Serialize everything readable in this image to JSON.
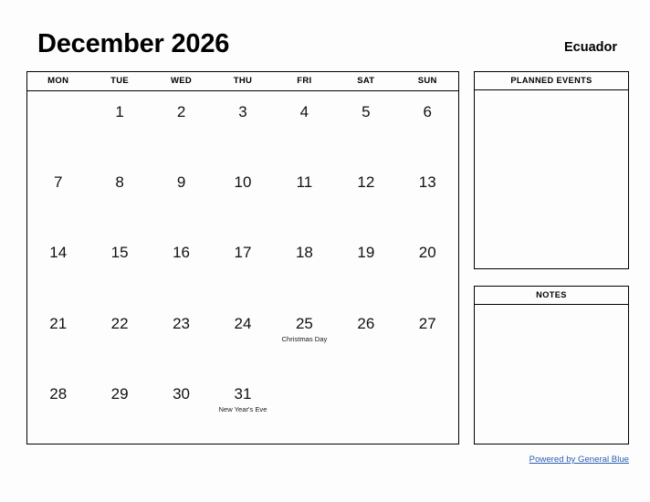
{
  "header": {
    "month_title": "December 2026",
    "country": "Ecuador"
  },
  "calendar": {
    "weekdays": [
      "MON",
      "TUE",
      "WED",
      "THU",
      "FRI",
      "SAT",
      "SUN"
    ],
    "weeks": [
      [
        {
          "day": "",
          "event": ""
        },
        {
          "day": "1",
          "event": ""
        },
        {
          "day": "2",
          "event": ""
        },
        {
          "day": "3",
          "event": ""
        },
        {
          "day": "4",
          "event": ""
        },
        {
          "day": "5",
          "event": ""
        },
        {
          "day": "6",
          "event": ""
        }
      ],
      [
        {
          "day": "7",
          "event": ""
        },
        {
          "day": "8",
          "event": ""
        },
        {
          "day": "9",
          "event": ""
        },
        {
          "day": "10",
          "event": ""
        },
        {
          "day": "11",
          "event": ""
        },
        {
          "day": "12",
          "event": ""
        },
        {
          "day": "13",
          "event": ""
        }
      ],
      [
        {
          "day": "14",
          "event": ""
        },
        {
          "day": "15",
          "event": ""
        },
        {
          "day": "16",
          "event": ""
        },
        {
          "day": "17",
          "event": ""
        },
        {
          "day": "18",
          "event": ""
        },
        {
          "day": "19",
          "event": ""
        },
        {
          "day": "20",
          "event": ""
        }
      ],
      [
        {
          "day": "21",
          "event": ""
        },
        {
          "day": "22",
          "event": ""
        },
        {
          "day": "23",
          "event": ""
        },
        {
          "day": "24",
          "event": ""
        },
        {
          "day": "25",
          "event": "Christmas Day"
        },
        {
          "day": "26",
          "event": ""
        },
        {
          "day": "27",
          "event": ""
        }
      ],
      [
        {
          "day": "28",
          "event": ""
        },
        {
          "day": "29",
          "event": ""
        },
        {
          "day": "30",
          "event": ""
        },
        {
          "day": "31",
          "event": "New Year's Eve"
        },
        {
          "day": "",
          "event": ""
        },
        {
          "day": "",
          "event": ""
        },
        {
          "day": "",
          "event": ""
        }
      ]
    ]
  },
  "panels": {
    "planned_events": {
      "title": "PLANNED EVENTS",
      "content": ""
    },
    "notes": {
      "title": "NOTES",
      "content": ""
    }
  },
  "footer": {
    "link_text": "Powered by General Blue",
    "link_color": "#2a5db0"
  }
}
